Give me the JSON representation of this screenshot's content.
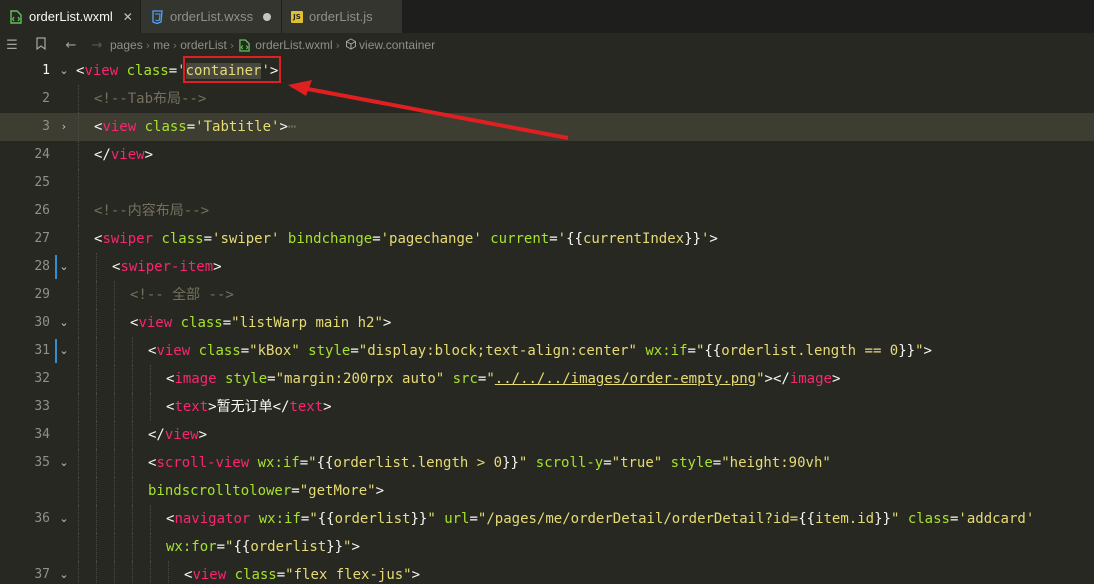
{
  "tabs": [
    {
      "label": "orderList.wxml",
      "icon": "wxml-file-icon",
      "active": true,
      "close": "✕"
    },
    {
      "label": "orderList.wxss",
      "icon": "wxss-file-icon",
      "active": false
    },
    {
      "label": "orderList.js",
      "icon": "js-file-icon",
      "active": false
    }
  ],
  "breadcrumb": {
    "items": [
      "pages",
      "me",
      "orderList",
      "orderList.wxml",
      "view.container"
    ]
  },
  "gutter": [
    "1",
    "2",
    "3",
    "24",
    "25",
    "26",
    "27",
    "28",
    "29",
    "30",
    "31",
    "32",
    "33",
    "34",
    "35",
    "",
    "36",
    "",
    "37"
  ],
  "colors": {
    "accent_annotation": "#e02020",
    "editor_bg": "#272822",
    "tag": "#f92672",
    "attr": "#a6e22e",
    "string": "#e6db74",
    "comment": "#75715e"
  },
  "code": {
    "l1": {
      "o": "<",
      "tag": "view",
      "attr": " class",
      "eq": "=",
      "q1": "'",
      "sel": "container",
      "q2": "'",
      "cl": ">"
    },
    "l2": {
      "comment": "<!--Tab布局-->"
    },
    "l3": {
      "o": "<",
      "tag": "view",
      "attr": " class",
      "eq": "=",
      "str": "'Tabtitle'",
      "cl": ">",
      "fold": "⋯"
    },
    "l24": {
      "o": "</",
      "tag": "view",
      "cl": ">"
    },
    "l26": {
      "comment": "<!--内容布局-->"
    },
    "l27": {
      "o": "<",
      "tag": "swiper",
      "a1": " class",
      "eq1": "=",
      "s1": "'swiper'",
      "a2": " bindchange",
      "eq2": "=",
      "s2": "'pagechange'",
      "a3": " current",
      "eq3": "=",
      "s3a": "'",
      "m1": "{{",
      "v": "currentIndex",
      "m2": "}}",
      "s3b": "'",
      "cl": ">"
    },
    "l28": {
      "o": "<",
      "tag": "swiper-item",
      "cl": ">"
    },
    "l29": {
      "comment": "<!-- 全部 -->"
    },
    "l30": {
      "o": "<",
      "tag": "view",
      "attr": " class",
      "eq": "=",
      "str": "\"listWarp main h2\"",
      "cl": ">"
    },
    "l31": {
      "o": "<",
      "tag": "view",
      "a1": " class",
      "eq1": "=",
      "s1": "\"kBox\"",
      "a2": " style",
      "eq2": "=",
      "s2": "\"display:block;text-align:center\"",
      "a3": " wx:if",
      "eq3": "=",
      "s3a": "\"",
      "m1": "{{",
      "v": "orderlist.length == 0",
      "m2": "}}",
      "s3b": "\"",
      "cl": ">"
    },
    "l32": {
      "o": "<",
      "tag": "image",
      "a1": " style",
      "eq1": "=",
      "s1": "\"margin:200rpx auto\"",
      "a2": " src",
      "eq2": "=",
      "s2a": "\"",
      "s2u": "../../../images/order-empty.png",
      "s2b": "\"",
      "cl": ">",
      "o2": "</",
      "tag2": "image",
      "cl2": ">"
    },
    "l33": {
      "o": "<",
      "tag": "text",
      "cl": ">",
      "text": "暂无订单",
      "o2": "</",
      "tag2": "text",
      "cl2": ">"
    },
    "l34": {
      "o": "</",
      "tag": "view",
      "cl": ">"
    },
    "l35": {
      "o": "<",
      "tag": "scroll-view",
      "a1": " wx:if",
      "eq1": "=",
      "s1a": "\"",
      "m1": "{{",
      "v1": "orderlist.length > 0",
      "m2": "}}",
      "s1b": "\"",
      "a2": " scroll-y",
      "eq2": "=",
      "s2": "\"true\"",
      "a3": " style",
      "eq3": "=",
      "s3": "\"height:90vh\""
    },
    "l35b": {
      "a4": "bindscrolltolower",
      "eq4": "=",
      "s4": "\"getMore\"",
      "cl": ">"
    },
    "l36": {
      "o": "<",
      "tag": "navigator",
      "a1": " wx:if",
      "eq1": "=",
      "s1a": "\"",
      "m1": "{{",
      "v1": "orderlist",
      "m2": "}}",
      "s1b": "\"",
      "a2": " url",
      "eq2": "=",
      "s2a": "\"/pages/me/orderDetail/orderDetail?id=",
      "m3": "{{",
      "v2": "item.id",
      "m4": "}}",
      "s2b": "\"",
      "a3": " class",
      "eq3": "=",
      "s3": "'addcard'"
    },
    "l36b": {
      "a4": "wx:for",
      "eq4": "=",
      "s4a": "\"",
      "m1": "{{",
      "v": "orderlist",
      "m2": "}}",
      "s4b": "\"",
      "cl": ">"
    },
    "l37": {
      "o": "<",
      "tag": "view",
      "attr": " class",
      "eq": "=",
      "str": "\"flex flex-jus\"",
      "cl": ">"
    }
  }
}
